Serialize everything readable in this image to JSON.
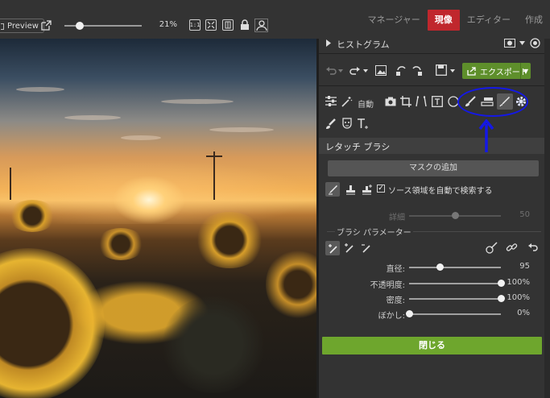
{
  "topbar": {
    "preview_label": "Preview",
    "zoom_percent": "21%",
    "zoom_slider_fraction": 0.2,
    "fit_1to1_label": "1:1",
    "mode_tabs": [
      {
        "label": "マネージャー",
        "active": false
      },
      {
        "label": "現像",
        "active": true
      },
      {
        "label": "エディター",
        "active": false
      },
      {
        "label": "作成",
        "active": false
      }
    ]
  },
  "panel": {
    "histogram_label": "ヒストグラム",
    "export_label": "エクスポート",
    "auto_label": "自動",
    "retouch_title": "レタッチ ブラシ",
    "add_mask_label": "マスクの追加",
    "auto_source_label": "ソース領域を自動で検索する",
    "auto_source_checked": true,
    "detail": {
      "label": "詳細",
      "value": "50",
      "fraction": 0.5
    },
    "params_title": "ブラシ パラメーター",
    "sliders": [
      {
        "label": "直径:",
        "value": "95",
        "fraction": 0.33
      },
      {
        "label": "不透明度:",
        "value": "100%",
        "fraction": 1.0
      },
      {
        "label": "密度:",
        "value": "100%",
        "fraction": 1.0
      },
      {
        "label": "ぼかし:",
        "value": "0%",
        "fraction": 0.0
      }
    ],
    "close_label": "閉じる"
  },
  "colors": {
    "active_tab": "#c0272d",
    "export_green": "#5e8f2b",
    "close_green": "#6ea62d",
    "annotation_blue": "#1418e6"
  }
}
